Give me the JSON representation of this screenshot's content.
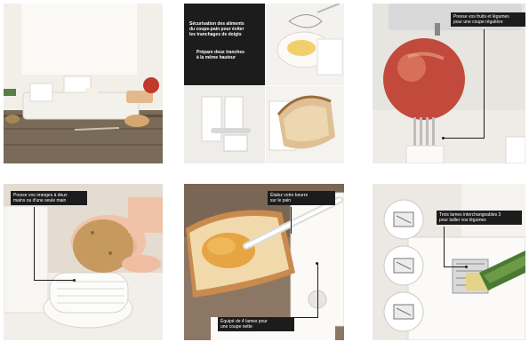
{
  "panels": {
    "p2": {
      "title": "Sécurisation des aliments\ndu coupe-pain pour éviter\nles tranchages de doigts",
      "note": "Prépare deux tranches\nà la même hauteur"
    },
    "p3": {
      "callout": "Presse vos fruits et légumes\npour une coupe régulière"
    },
    "p4": {
      "callout": "Presse vos oranges à deux\nmains ou d'une seule main"
    },
    "p5": {
      "callout": "Étalez votre beurre\nsur le pain",
      "bottom": "Équipé de 4 lames pour\nune coupe nette"
    },
    "p6": {
      "callout": "Trois lames interchangeables 3\npour tailler vos légumes"
    }
  },
  "colors": {
    "label_bg": "#1c1c1c",
    "label_text": "#ffffff"
  }
}
